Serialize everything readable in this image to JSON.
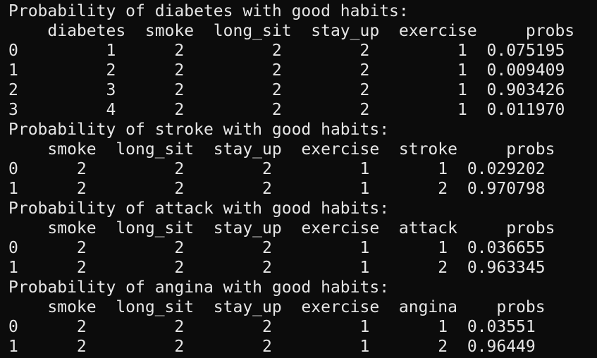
{
  "lines": [
    "Probability of diabetes with good habits:",
    "    diabetes  smoke  long_sit  stay_up  exercise     probs",
    "0         1      2         2        2         1  0.075195",
    "1         2      2         2        2         1  0.009409",
    "2         3      2         2        2         1  0.903426",
    "3         4      2         2        2         1  0.011970",
    "Probability of stroke with good habits:",
    "    smoke  long_sit  stay_up  exercise  stroke     probs",
    "0      2         2        2         1       1  0.029202",
    "1      2         2        2         1       2  0.970798",
    "Probability of attack with good habits:",
    "    smoke  long_sit  stay_up  exercise  attack     probs",
    "0      2         2        2         1       1  0.036655",
    "1      2         2        2         1       2  0.963345",
    "Probability of angina with good habits:",
    "    smoke  long_sit  stay_up  exercise  angina    probs",
    "0      2         2        2         1       1  0.03551",
    "1      2         2        2         1       2  0.96449"
  ]
}
